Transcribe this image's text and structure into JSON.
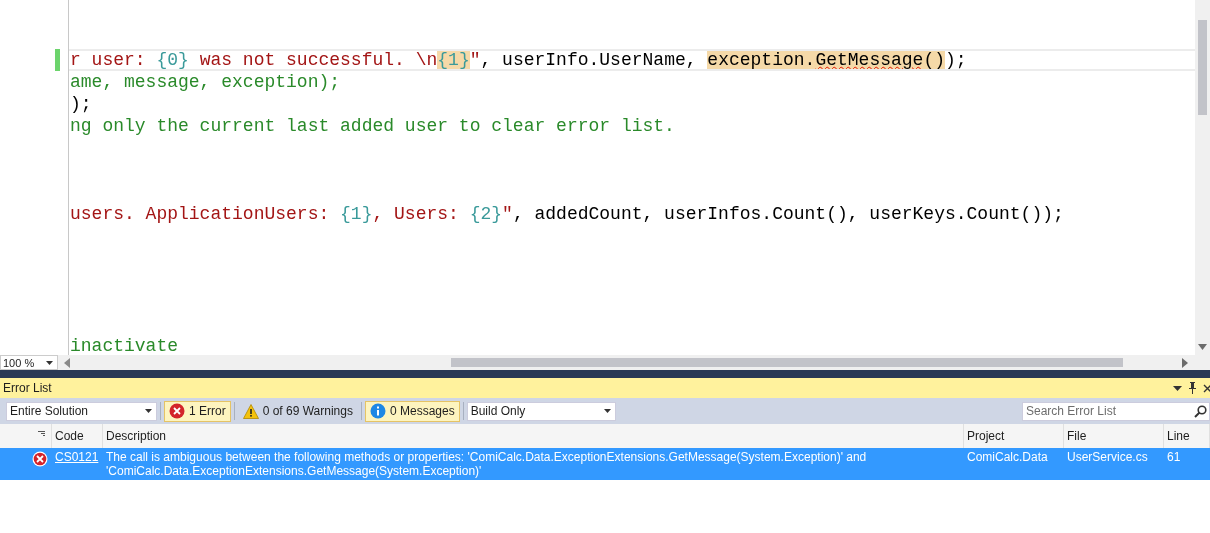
{
  "editor": {
    "lines": [
      {
        "kind": "blank",
        "current": false,
        "changed": false
      },
      {
        "kind": "blank",
        "current": false,
        "changed": false
      },
      {
        "kind": "code",
        "current": true,
        "changed": true,
        "tokens": [
          {
            "kind": "string",
            "text": "r user: "
          },
          {
            "kind": "format",
            "text": "{0}"
          },
          {
            "kind": "string",
            "text": " was not successful. \\n"
          },
          {
            "kind": "format_match",
            "text": "{1}"
          },
          {
            "kind": "string",
            "text": "\""
          },
          {
            "kind": "plain",
            "text": ", userInfo.UserName, "
          },
          {
            "kind": "highlight",
            "text": "exception."
          },
          {
            "kind": "highlight_error",
            "text": "GetMessage"
          },
          {
            "kind": "highlight",
            "text": "()"
          },
          {
            "kind": "plain",
            "text": ");"
          }
        ]
      },
      {
        "kind": "code",
        "current": false,
        "changed": false,
        "tokens": [
          {
            "kind": "comment",
            "text": "ame, message, exception);"
          }
        ]
      },
      {
        "kind": "code",
        "current": false,
        "changed": false,
        "tokens": [
          {
            "kind": "plain",
            "text": ");"
          }
        ]
      },
      {
        "kind": "code",
        "current": false,
        "changed": false,
        "tokens": [
          {
            "kind": "comment",
            "text": "ng only the current last added user to clear error list."
          }
        ]
      },
      {
        "kind": "blank",
        "current": false,
        "changed": false
      },
      {
        "kind": "blank",
        "current": false,
        "changed": false
      },
      {
        "kind": "blank",
        "current": false,
        "changed": false
      },
      {
        "kind": "code",
        "current": false,
        "changed": false,
        "tokens": [
          {
            "kind": "string",
            "text": "users. ApplicationUsers: "
          },
          {
            "kind": "format",
            "text": "{1}"
          },
          {
            "kind": "string",
            "text": ", Users: "
          },
          {
            "kind": "format",
            "text": "{2}"
          },
          {
            "kind": "string",
            "text": "\""
          },
          {
            "kind": "plain",
            "text": ", addedCount, userInfos.Count(), userKeys.Count());"
          }
        ]
      },
      {
        "kind": "blank",
        "current": false,
        "changed": false
      },
      {
        "kind": "blank",
        "current": false,
        "changed": false
      },
      {
        "kind": "blank",
        "current": false,
        "changed": false
      },
      {
        "kind": "blank",
        "current": false,
        "changed": false
      },
      {
        "kind": "blank",
        "current": false,
        "changed": false
      },
      {
        "kind": "code",
        "current": false,
        "changed": false,
        "tokens": [
          {
            "kind": "comment",
            "text": "inactivate"
          }
        ]
      }
    ],
    "zoom": "100 %"
  },
  "error_list": {
    "title": "Error List",
    "scope": "Entire Solution",
    "filters": [
      {
        "kind": "error",
        "label": "1 Error",
        "selected": true
      },
      {
        "kind": "warning",
        "label": "0 of 69 Warnings",
        "selected": false
      },
      {
        "kind": "info",
        "label": "0 Messages",
        "selected": true
      }
    ],
    "build_filter": "Build Only",
    "search": {
      "placeholder": "Search Error List"
    },
    "columns": [
      "Code",
      "Description",
      "Project",
      "File",
      "Line"
    ],
    "rows": [
      {
        "kind": "error",
        "selected": true,
        "code": "CS0121",
        "description": "The call is ambiguous between the following methods or properties: 'ComiCalc.Data.ExceptionExtensions.GetMessage(System.Exception)' and 'ComiCalc.Data.ExceptionExtensions.GetMessage(System.Exception)'",
        "project": "ComiCalc.Data",
        "file": "UserService.cs",
        "line": "61"
      }
    ]
  }
}
